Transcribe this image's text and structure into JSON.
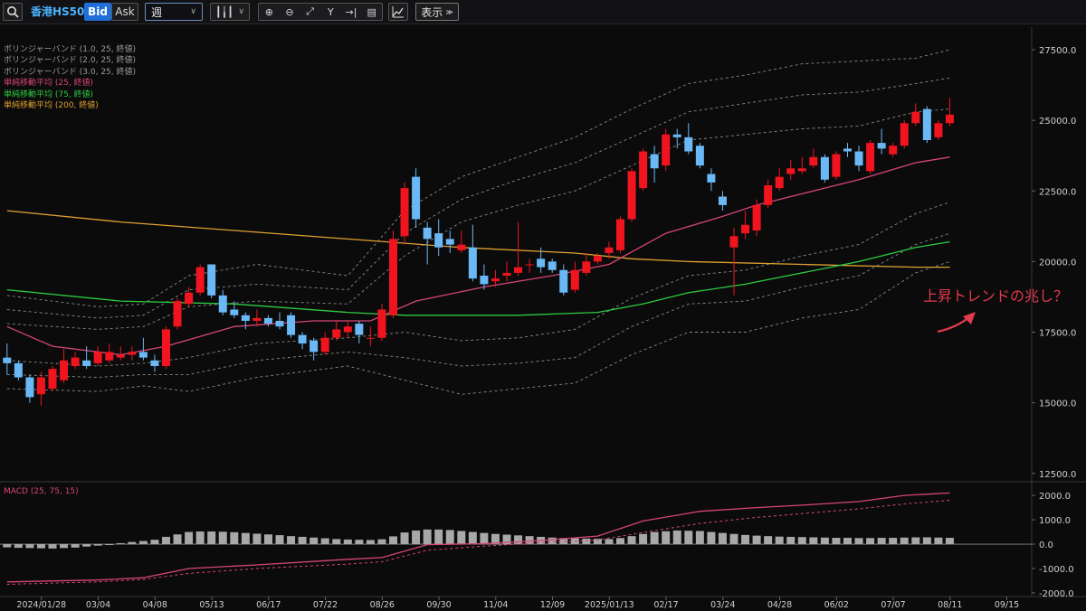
{
  "toolbar": {
    "symbol": "香港HS50",
    "bid_label": "Bid",
    "ask_label": "Ask",
    "period": "週",
    "display_label": "表示",
    "icons": [
      "search-icon",
      "zoom-in-icon",
      "zoom-out-icon",
      "fit-icon",
      "crosshair-icon",
      "jump-icon",
      "document-icon",
      "add-indicator-icon"
    ]
  },
  "legend": [
    {
      "text": "ボリンジャーバンド (1.0, 25, 終値)",
      "color": "#9a9a9a"
    },
    {
      "text": "ボリンジャーバンド (2.0, 25, 終値)",
      "color": "#9a9a9a"
    },
    {
      "text": "ボリンジャーバンド (3.0, 25, 終値)",
      "color": "#9a9a9a"
    },
    {
      "text": "単純移動平均 (25, 終値)",
      "color": "#d6457a"
    },
    {
      "text": "単純移動平均 (75, 終値)",
      "color": "#2ecc40"
    },
    {
      "text": "単純移動平均 (200, 終値)",
      "color": "#e0a030"
    }
  ],
  "macd_label": "MACD (25, 75, 15)",
  "annotation": "上昇トレンドの兆し？",
  "chart_data": {
    "type": "candlestick",
    "colors": {
      "up": "#f0141e",
      "down": "#6ab8f5",
      "sma25": "#d6457a",
      "sma75": "#2ecc40",
      "sma200": "#e0a030",
      "band": "#8a8a8a"
    },
    "y_ticks": [
      "27500.0",
      "25000.0",
      "22500.0",
      "20000.0",
      "17500.0",
      "15000.0",
      "12500.0"
    ],
    "y_values": [
      27500,
      25000,
      22500,
      20000,
      17500,
      15000,
      12500
    ],
    "ylim": [
      12300,
      28300
    ],
    "x_ticks": [
      {
        "i": 0,
        "label": "2024/01/28"
      },
      {
        "i": 5,
        "label": "03/04"
      },
      {
        "i": 10,
        "label": "04/08"
      },
      {
        "i": 15,
        "label": "05/13"
      },
      {
        "i": 20,
        "label": "06/17"
      },
      {
        "i": 25,
        "label": "07/22"
      },
      {
        "i": 30,
        "label": "08/26"
      },
      {
        "i": 35,
        "label": "09/30"
      },
      {
        "i": 40,
        "label": "11/04"
      },
      {
        "i": 45,
        "label": "12/09"
      },
      {
        "i": 50,
        "label": "2025/01/13"
      },
      {
        "i": 55,
        "label": "02/17"
      },
      {
        "i": 60,
        "label": "03/24"
      },
      {
        "i": 65,
        "label": "04/28"
      },
      {
        "i": 70,
        "label": "06/02"
      },
      {
        "i": 75,
        "label": "07/07"
      },
      {
        "i": 80,
        "label": "08/11"
      },
      {
        "i": 85,
        "label": "09/15"
      }
    ],
    "candles": [
      [
        16600,
        16400,
        17100,
        16000
      ],
      [
        16400,
        15900,
        16500,
        15800
      ],
      [
        15900,
        15200,
        16000,
        15000
      ],
      [
        15300,
        15900,
        16100,
        14900
      ],
      [
        15500,
        16200,
        16300,
        15400
      ],
      [
        15800,
        16500,
        16900,
        15700
      ],
      [
        16300,
        16600,
        16800,
        16200
      ],
      [
        16500,
        16300,
        17000,
        16200
      ],
      [
        16400,
        16800,
        17000,
        16300
      ],
      [
        16500,
        16800,
        17100,
        16400
      ],
      [
        16600,
        16700,
        17000,
        16500
      ],
      [
        16700,
        16800,
        17000,
        16500
      ],
      [
        16800,
        16600,
        17300,
        16500
      ],
      [
        16500,
        16300,
        16700,
        16100
      ],
      [
        16300,
        17600,
        17700,
        16200
      ],
      [
        17700,
        18600,
        18700,
        17600
      ],
      [
        18500,
        18900,
        19100,
        18400
      ],
      [
        18900,
        19800,
        19900,
        18800
      ],
      [
        19900,
        18800,
        19900,
        18700
      ],
      [
        18800,
        18200,
        19000,
        18100
      ],
      [
        18300,
        18100,
        18600,
        18000
      ],
      [
        18100,
        17900,
        18200,
        17600
      ],
      [
        17900,
        18000,
        18300,
        17700
      ],
      [
        18000,
        17800,
        18100,
        17700
      ],
      [
        17900,
        17700,
        18200,
        17600
      ],
      [
        18100,
        17400,
        18200,
        17300
      ],
      [
        17400,
        17100,
        17500,
        16900
      ],
      [
        17200,
        16800,
        17300,
        16500
      ],
      [
        16800,
        17300,
        17500,
        16700
      ],
      [
        17300,
        17600,
        17900,
        17200
      ],
      [
        17500,
        17700,
        17900,
        17300
      ],
      [
        17800,
        17400,
        17900,
        17100
      ],
      [
        17300,
        17300,
        17700,
        17000
      ],
      [
        17300,
        18300,
        18500,
        17200
      ],
      [
        18100,
        20800,
        21100,
        18000
      ],
      [
        20900,
        22600,
        22800,
        20600
      ],
      [
        23000,
        21500,
        23300,
        21200
      ],
      [
        21200,
        20800,
        21400,
        19900
      ],
      [
        21000,
        20500,
        21500,
        20200
      ],
      [
        20800,
        20600,
        21100,
        20300
      ],
      [
        20400,
        20600,
        21100,
        20300
      ],
      [
        20500,
        19400,
        21300,
        19300
      ],
      [
        19500,
        19200,
        19900,
        19000
      ],
      [
        19300,
        19400,
        19700,
        19100
      ],
      [
        19500,
        19600,
        20000,
        19300
      ],
      [
        19600,
        19800,
        21400,
        19500
      ],
      [
        19900,
        19900,
        20100,
        19600
      ],
      [
        20100,
        19800,
        20500,
        19600
      ],
      [
        20000,
        19700,
        20100,
        19600
      ],
      [
        19700,
        18900,
        19900,
        18800
      ],
      [
        19000,
        19700,
        20000,
        18900
      ],
      [
        19600,
        20000,
        20300,
        19500
      ],
      [
        20000,
        20200,
        20300,
        19900
      ],
      [
        20300,
        20500,
        20700,
        20100
      ],
      [
        20400,
        21500,
        21600,
        20300
      ],
      [
        21500,
        23200,
        23300,
        21400
      ],
      [
        22600,
        23900,
        24000,
        22500
      ],
      [
        23800,
        23300,
        24100,
        22800
      ],
      [
        23400,
        24500,
        24700,
        23200
      ],
      [
        24500,
        24400,
        24700,
        24000
      ],
      [
        24400,
        23900,
        24900,
        23800
      ],
      [
        24100,
        23400,
        24200,
        23300
      ],
      [
        23100,
        22800,
        23300,
        22500
      ],
      [
        22300,
        22000,
        22500,
        21800
      ],
      [
        20500,
        20900,
        21200,
        18800
      ],
      [
        21000,
        21300,
        21800,
        20800
      ],
      [
        21100,
        22000,
        22200,
        20900
      ],
      [
        22000,
        22700,
        22900,
        21900
      ],
      [
        22600,
        23000,
        23300,
        22500
      ],
      [
        23100,
        23300,
        23600,
        22900
      ],
      [
        23200,
        23300,
        23700,
        23100
      ],
      [
        23400,
        23700,
        24000,
        23300
      ],
      [
        23700,
        22900,
        23800,
        22800
      ],
      [
        23000,
        23800,
        23900,
        22900
      ],
      [
        24000,
        23900,
        24200,
        23700
      ],
      [
        23900,
        23400,
        24100,
        23200
      ],
      [
        23200,
        24200,
        24300,
        23100
      ],
      [
        24200,
        24000,
        24700,
        23800
      ],
      [
        23800,
        24100,
        24200,
        23700
      ],
      [
        24100,
        24900,
        25000,
        24000
      ],
      [
        24900,
        25300,
        25600,
        24800
      ],
      [
        25400,
        24300,
        25500,
        24200
      ],
      [
        24400,
        24900,
        25000,
        24300
      ],
      [
        24900,
        25200,
        25800,
        24800
      ]
    ],
    "sma25": [
      [
        0,
        17700
      ],
      [
        4,
        17000
      ],
      [
        10,
        16700
      ],
      [
        14,
        17000
      ],
      [
        20,
        17700
      ],
      [
        27,
        17900
      ],
      [
        32,
        17900
      ],
      [
        36,
        18600
      ],
      [
        42,
        19100
      ],
      [
        48,
        19500
      ],
      [
        53,
        19900
      ],
      [
        58,
        21000
      ],
      [
        63,
        21600
      ],
      [
        66,
        22000
      ],
      [
        70,
        22400
      ],
      [
        75,
        22900
      ],
      [
        80,
        23500
      ],
      [
        83,
        23700
      ]
    ],
    "sma75": [
      [
        0,
        19000
      ],
      [
        10,
        18600
      ],
      [
        20,
        18500
      ],
      [
        30,
        18200
      ],
      [
        35,
        18100
      ],
      [
        45,
        18100
      ],
      [
        52,
        18200
      ],
      [
        56,
        18500
      ],
      [
        60,
        18900
      ],
      [
        65,
        19200
      ],
      [
        70,
        19600
      ],
      [
        75,
        20000
      ],
      [
        80,
        20500
      ],
      [
        83,
        20700
      ]
    ],
    "sma200": [
      [
        0,
        21800
      ],
      [
        10,
        21400
      ],
      [
        20,
        21100
      ],
      [
        30,
        20800
      ],
      [
        40,
        20500
      ],
      [
        50,
        20300
      ],
      [
        55,
        20100
      ],
      [
        60,
        20000
      ],
      [
        70,
        19900
      ],
      [
        80,
        19800
      ],
      [
        83,
        19800
      ]
    ],
    "bb_upper3": [
      [
        0,
        18800
      ],
      [
        8,
        18400
      ],
      [
        12,
        18500
      ],
      [
        16,
        19500
      ],
      [
        22,
        19900
      ],
      [
        30,
        19500
      ],
      [
        35,
        21800
      ],
      [
        40,
        23000
      ],
      [
        45,
        23700
      ],
      [
        50,
        24400
      ],
      [
        55,
        25400
      ],
      [
        60,
        26300
      ],
      [
        65,
        26600
      ],
      [
        70,
        27000
      ],
      [
        75,
        27100
      ],
      [
        80,
        27200
      ],
      [
        83,
        27500
      ]
    ],
    "bb_upper2": [
      [
        0,
        18300
      ],
      [
        8,
        18000
      ],
      [
        12,
        18100
      ],
      [
        16,
        19000
      ],
      [
        22,
        19200
      ],
      [
        30,
        19000
      ],
      [
        35,
        21000
      ],
      [
        40,
        22200
      ],
      [
        45,
        22900
      ],
      [
        50,
        23500
      ],
      [
        55,
        24400
      ],
      [
        60,
        25300
      ],
      [
        65,
        25600
      ],
      [
        70,
        25900
      ],
      [
        75,
        26000
      ],
      [
        80,
        26300
      ],
      [
        83,
        26500
      ]
    ],
    "bb_upper1": [
      [
        0,
        17800
      ],
      [
        8,
        17600
      ],
      [
        12,
        17700
      ],
      [
        16,
        18400
      ],
      [
        22,
        18600
      ],
      [
        30,
        18500
      ],
      [
        35,
        20200
      ],
      [
        40,
        21400
      ],
      [
        45,
        22000
      ],
      [
        50,
        22500
      ],
      [
        55,
        23400
      ],
      [
        60,
        24300
      ],
      [
        65,
        24500
      ],
      [
        70,
        24700
      ],
      [
        75,
        24800
      ],
      [
        80,
        25300
      ],
      [
        83,
        25400
      ]
    ],
    "bb_lower1": [
      [
        0,
        16500
      ],
      [
        8,
        16300
      ],
      [
        12,
        16400
      ],
      [
        16,
        16600
      ],
      [
        22,
        17100
      ],
      [
        30,
        17300
      ],
      [
        35,
        17500
      ],
      [
        40,
        17200
      ],
      [
        45,
        17300
      ],
      [
        50,
        17600
      ],
      [
        55,
        18700
      ],
      [
        60,
        19500
      ],
      [
        65,
        19700
      ],
      [
        70,
        20200
      ],
      [
        75,
        20600
      ],
      [
        80,
        21700
      ],
      [
        83,
        22100
      ]
    ],
    "bb_lower2": [
      [
        0,
        16000
      ],
      [
        8,
        15900
      ],
      [
        12,
        16000
      ],
      [
        16,
        16000
      ],
      [
        22,
        16500
      ],
      [
        30,
        16800
      ],
      [
        35,
        16600
      ],
      [
        40,
        16300
      ],
      [
        45,
        16400
      ],
      [
        50,
        16600
      ],
      [
        55,
        17700
      ],
      [
        60,
        18500
      ],
      [
        65,
        18600
      ],
      [
        70,
        19100
      ],
      [
        75,
        19500
      ],
      [
        80,
        20600
      ],
      [
        83,
        21000
      ]
    ],
    "bb_lower3": [
      [
        0,
        15500
      ],
      [
        8,
        15400
      ],
      [
        12,
        15600
      ],
      [
        16,
        15400
      ],
      [
        22,
        15900
      ],
      [
        30,
        16300
      ],
      [
        35,
        15800
      ],
      [
        40,
        15300
      ],
      [
        45,
        15500
      ],
      [
        50,
        15700
      ],
      [
        55,
        16700
      ],
      [
        60,
        17500
      ],
      [
        65,
        17500
      ],
      [
        70,
        18000
      ],
      [
        75,
        18300
      ],
      [
        80,
        19600
      ],
      [
        83,
        20000
      ]
    ],
    "macd": {
      "y_ticks": [
        "2000.0",
        "1000.0",
        "0.0",
        "-1000.0",
        "-2000.0"
      ],
      "y_values": [
        2000,
        1000,
        0,
        -1000,
        -2000
      ],
      "ylim": [
        -2150,
        2450
      ],
      "macd_line": [
        [
          0,
          -1550
        ],
        [
          8,
          -1470
        ],
        [
          12,
          -1380
        ],
        [
          16,
          -1000
        ],
        [
          22,
          -850
        ],
        [
          30,
          -620
        ],
        [
          33,
          -550
        ],
        [
          37,
          -20
        ],
        [
          42,
          20
        ],
        [
          47,
          150
        ],
        [
          52,
          330
        ],
        [
          56,
          950
        ],
        [
          61,
          1350
        ],
        [
          66,
          1500
        ],
        [
          70,
          1600
        ],
        [
          75,
          1750
        ],
        [
          79,
          2000
        ],
        [
          83,
          2100
        ]
      ],
      "signal_line": [
        [
          0,
          -1650
        ],
        [
          8,
          -1550
        ],
        [
          12,
          -1450
        ],
        [
          16,
          -1200
        ],
        [
          22,
          -1000
        ],
        [
          30,
          -820
        ],
        [
          33,
          -720
        ],
        [
          37,
          -250
        ],
        [
          42,
          -80
        ],
        [
          47,
          60
        ],
        [
          52,
          170
        ],
        [
          56,
          480
        ],
        [
          61,
          850
        ],
        [
          66,
          1100
        ],
        [
          70,
          1250
        ],
        [
          75,
          1450
        ],
        [
          79,
          1650
        ],
        [
          83,
          1800
        ]
      ],
      "histogram": [
        -130,
        -150,
        -160,
        -170,
        -180,
        -160,
        -140,
        -100,
        -60,
        -20,
        40,
        90,
        130,
        180,
        300,
        400,
        500,
        520,
        520,
        510,
        490,
        460,
        430,
        400,
        370,
        330,
        300,
        270,
        240,
        210,
        190,
        180,
        170,
        200,
        320,
        480,
        560,
        600,
        600,
        580,
        540,
        500,
        460,
        420,
        390,
        360,
        330,
        300,
        270,
        250,
        240,
        230,
        220,
        210,
        250,
        330,
        420,
        500,
        530,
        560,
        550,
        540,
        500,
        460,
        420,
        380,
        350,
        330,
        310,
        300,
        290,
        280,
        270,
        260,
        260,
        250,
        250,
        260,
        260,
        270,
        280,
        280,
        270,
        260
      ]
    }
  }
}
